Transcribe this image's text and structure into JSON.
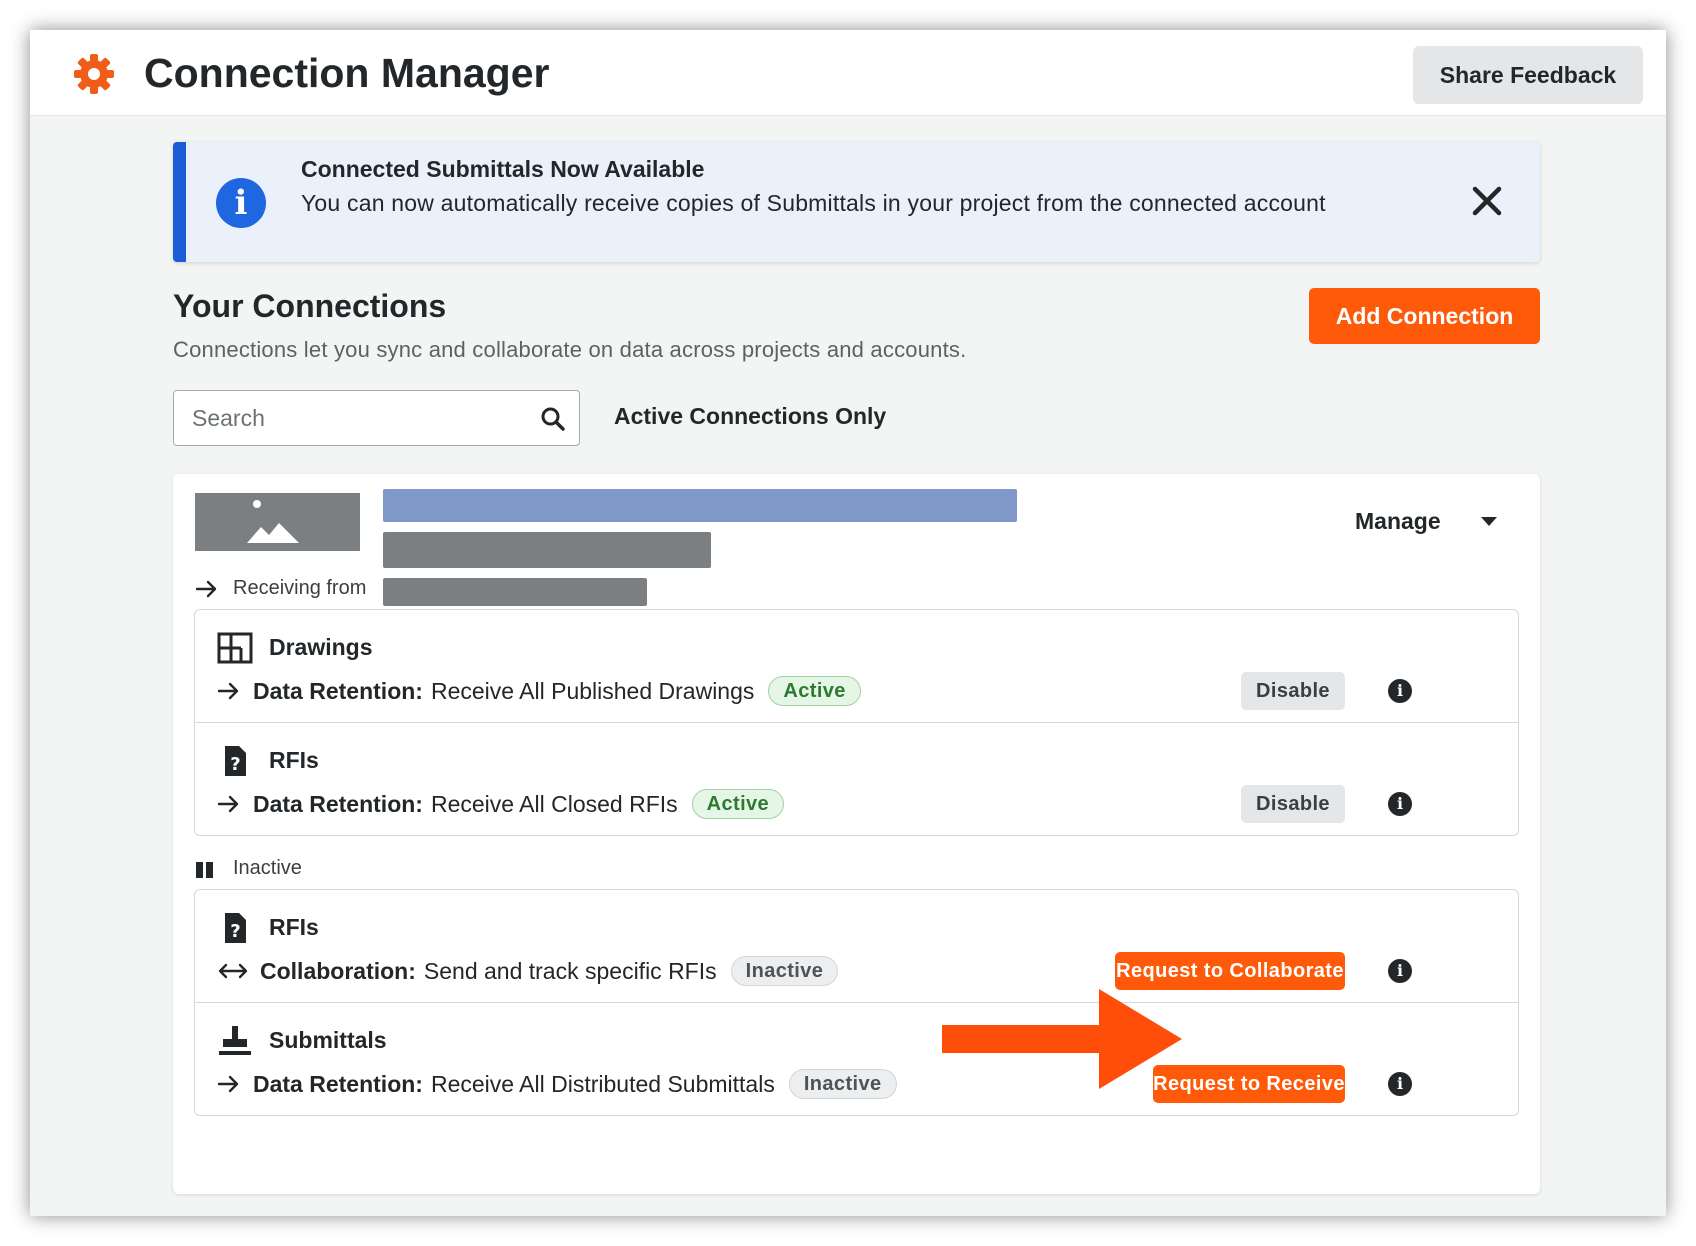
{
  "header": {
    "title": "Connection Manager",
    "feedback_label": "Share Feedback",
    "accent": "#ff5a0a"
  },
  "banner": {
    "title": "Connected Submittals Now Available",
    "text": "You can now automatically receive copies of Submittals in your project from the connected account",
    "accent": "#1b5dd6"
  },
  "connections": {
    "title": "Your Connections",
    "subtitle": "Connections let you sync and collaborate on data across projects and accounts.",
    "add_label": "Add Connection",
    "search_placeholder": "Search",
    "active_only_label": "Active Connections Only"
  },
  "card": {
    "manage_label": "Manage",
    "receiving_label": "Receiving from",
    "active_group": [
      {
        "tool": "Drawings",
        "icon": "drawings-icon",
        "detail_key": "Data Retention:",
        "detail_value": "Receive All Published Drawings",
        "status": "Active",
        "action": "Disable"
      },
      {
        "tool": "RFIs",
        "icon": "rfi-icon",
        "detail_key": "Data Retention:",
        "detail_value": "Receive All Closed RFIs",
        "status": "Active",
        "action": "Disable"
      }
    ],
    "inactive_label": "Inactive",
    "inactive_group": [
      {
        "tool": "RFIs",
        "icon": "rfi-icon",
        "detail_key": "Collaboration:",
        "detail_value": "Send and track specific RFIs",
        "status": "Inactive",
        "action": "Request to Collaborate"
      },
      {
        "tool": "Submittals",
        "icon": "submittals-icon",
        "detail_key": "Data Retention:",
        "detail_value": "Receive All Distributed Submittals",
        "status": "Inactive",
        "action": "Request to Receive"
      }
    ]
  }
}
